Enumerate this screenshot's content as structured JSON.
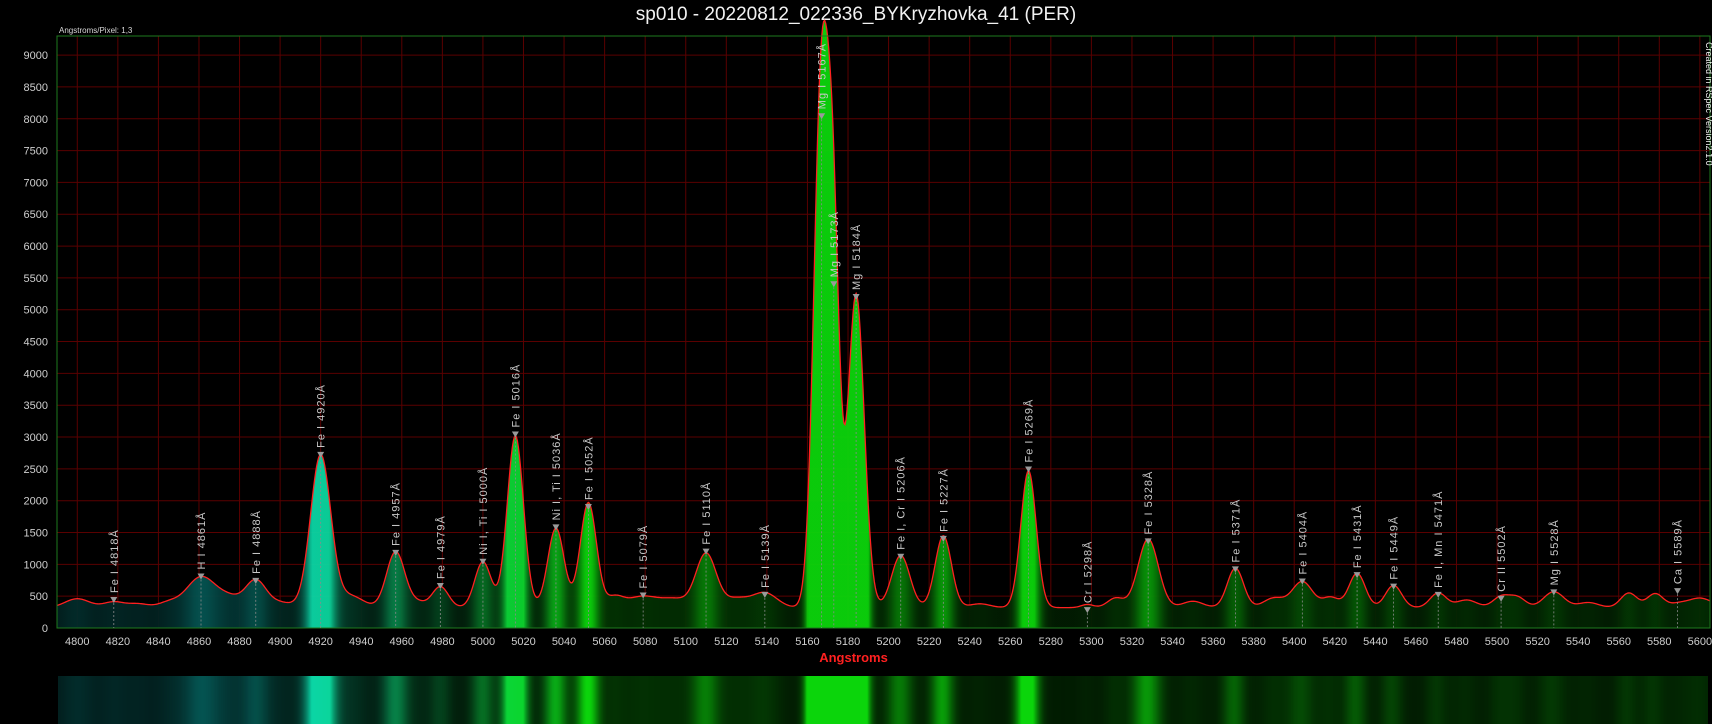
{
  "title": "sp010 - 20220812_022336_BYKryzhovka_41 (PER)",
  "dispersion_label": "Angstroms/Pixel: 1,3",
  "credit_label": "Created in RSpec Version2.1.0",
  "colors": {
    "background": "#000000",
    "grid": "#5a0000",
    "curve": "#ff2020",
    "axis_label": "#ff2020",
    "plot_border": "#1e7a1e",
    "marker": "#9a9a9a"
  },
  "chart_data": {
    "type": "line",
    "title": "sp010 - 20220812_022336_BYKryzhovka_41 (PER)",
    "xlabel": "Angstroms",
    "ylabel": "",
    "xlim": [
      4790,
      5605
    ],
    "ylim": [
      0,
      9300
    ],
    "x_ticks": [
      4800,
      4820,
      4840,
      4860,
      4880,
      4900,
      4920,
      4940,
      4960,
      4980,
      5000,
      5020,
      5040,
      5060,
      5080,
      5100,
      5120,
      5140,
      5160,
      5180,
      5200,
      5220,
      5240,
      5260,
      5280,
      5300,
      5320,
      5340,
      5360,
      5380,
      5400,
      5420,
      5440,
      5460,
      5480,
      5500,
      5520,
      5540,
      5560,
      5580,
      5600
    ],
    "y_ticks": [
      0,
      500,
      1000,
      1500,
      2000,
      2500,
      3000,
      3500,
      4000,
      4500,
      5000,
      5500,
      6000,
      6500,
      7000,
      7500,
      8000,
      8500,
      9000
    ],
    "grid": true,
    "baseline": 320,
    "series": [
      {
        "peaks": [
          [
            4800,
            140,
            6
          ],
          [
            4818,
            90,
            5
          ],
          [
            4830,
            60,
            5
          ],
          [
            4845,
            80,
            5
          ],
          [
            4861,
            480,
            7
          ],
          [
            4875,
            150,
            6
          ],
          [
            4888,
            420,
            5
          ],
          [
            4900,
            80,
            6
          ],
          [
            4920,
            2400,
            5
          ],
          [
            4935,
            180,
            6
          ],
          [
            4957,
            880,
            4.5
          ],
          [
            4968,
            80,
            4
          ],
          [
            4979,
            330,
            4
          ],
          [
            5000,
            720,
            4
          ],
          [
            5016,
            2700,
            4
          ],
          [
            5036,
            1250,
            4
          ],
          [
            5052,
            1650,
            4
          ],
          [
            5065,
            150,
            4
          ],
          [
            5079,
            180,
            8
          ],
          [
            5095,
            120,
            6
          ],
          [
            5110,
            850,
            5
          ],
          [
            5125,
            140,
            6
          ],
          [
            5139,
            230,
            6
          ],
          [
            5167,
            8320,
            3.8
          ],
          [
            5173,
            4700,
            3
          ],
          [
            5184,
            4930,
            4
          ],
          [
            5206,
            820,
            4.5
          ],
          [
            5227,
            1130,
            4
          ],
          [
            5245,
            60,
            5
          ],
          [
            5269,
            2150,
            3.8
          ],
          [
            5298,
            50,
            3
          ],
          [
            5312,
            150,
            4
          ],
          [
            5328,
            1080,
            5
          ],
          [
            5350,
            100,
            5
          ],
          [
            5371,
            620,
            4
          ],
          [
            5390,
            150,
            5
          ],
          [
            5404,
            410,
            5
          ],
          [
            5418,
            160,
            4
          ],
          [
            5431,
            540,
            4
          ],
          [
            5449,
            350,
            4
          ],
          [
            5471,
            230,
            4
          ],
          [
            5485,
            120,
            5
          ],
          [
            5502,
            170,
            4
          ],
          [
            5510,
            160,
            4
          ],
          [
            5528,
            250,
            5
          ],
          [
            5545,
            80,
            5
          ],
          [
            5565,
            230,
            4
          ],
          [
            5578,
            220,
            4
          ],
          [
            5589,
            50,
            4
          ],
          [
            5600,
            150,
            6
          ]
        ]
      }
    ],
    "lines": [
      {
        "label": "Fe I 4818Å",
        "x": 4818,
        "y": 440
      },
      {
        "label": "H I 4861Å",
        "x": 4861,
        "y": 810
      },
      {
        "label": "Fe I 4888Å",
        "x": 4888,
        "y": 740
      },
      {
        "label": "Fe I 4920Å",
        "x": 4920,
        "y": 2720
      },
      {
        "label": "Fe I 4957Å",
        "x": 4957,
        "y": 1180
      },
      {
        "label": "Fe I 4979Å",
        "x": 4979,
        "y": 660
      },
      {
        "label": "Ni I, Ti I 5000Å",
        "x": 5000,
        "y": 1040
      },
      {
        "label": "Fe I 5016Å",
        "x": 5016,
        "y": 3040
      },
      {
        "label": "Ni I, Ti I 5036Å",
        "x": 5036,
        "y": 1580
      },
      {
        "label": "Fe I 5052Å",
        "x": 5052,
        "y": 1900
      },
      {
        "label": "Fe I 5079Å",
        "x": 5079,
        "y": 510
      },
      {
        "label": "Fe I 5110Å",
        "x": 5110,
        "y": 1200
      },
      {
        "label": "Fe I 5139Å",
        "x": 5139,
        "y": 520
      },
      {
        "label": "Mg I 5167Å",
        "x": 5167,
        "y": 8040
      },
      {
        "label": "Mg I 5173Å",
        "x": 5173,
        "y": 5400
      },
      {
        "label": "Mg I 5184Å",
        "x": 5184,
        "y": 5200
      },
      {
        "label": "Fe I, Cr I 5206Å",
        "x": 5206,
        "y": 1120
      },
      {
        "label": "Fe I 5227Å",
        "x": 5227,
        "y": 1400
      },
      {
        "label": "Fe I 5269Å",
        "x": 5269,
        "y": 2490
      },
      {
        "label": "Cr I 5298Å",
        "x": 5298,
        "y": 280
      },
      {
        "label": "Fe I 5328Å",
        "x": 5328,
        "y": 1360
      },
      {
        "label": "Fe I 5371Å",
        "x": 5371,
        "y": 920
      },
      {
        "label": "Fe I 5404Å",
        "x": 5404,
        "y": 730
      },
      {
        "label": "Fe I 5431Å",
        "x": 5431,
        "y": 830
      },
      {
        "label": "Fe I 5449Å",
        "x": 5449,
        "y": 650
      },
      {
        "label": "Fe I, Mn I 5471Å",
        "x": 5471,
        "y": 520
      },
      {
        "label": "Cr II 5502Å",
        "x": 5502,
        "y": 460
      },
      {
        "label": "Mg I 5528Å",
        "x": 5528,
        "y": 560
      },
      {
        "label": "Ca I 5589Å",
        "x": 5589,
        "y": 580
      }
    ]
  }
}
